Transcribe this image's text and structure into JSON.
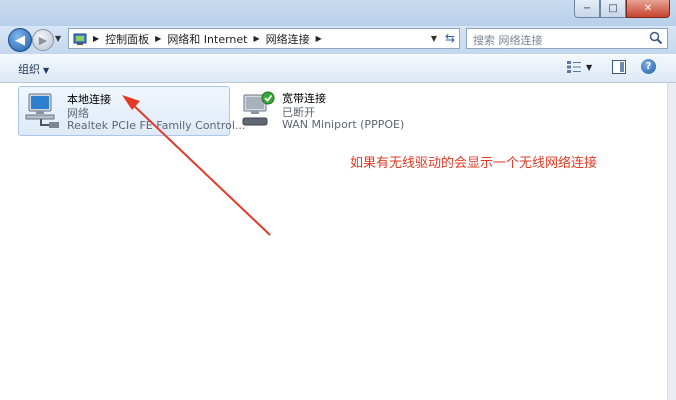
{
  "window": {
    "caption": {
      "minimize_glyph": "−",
      "maximize_glyph": "□",
      "close_glyph": "✕"
    }
  },
  "nav": {
    "back_glyph": "◀",
    "forward_glyph": "▶",
    "breadcrumb": [
      "控制面板",
      "网络和 Internet",
      "网络连接"
    ],
    "search_placeholder": "搜索 网络连接"
  },
  "toolbar": {
    "organize_label": "组织"
  },
  "connections": [
    {
      "name": "本地连接",
      "type": "网络",
      "device": "Realtek PCIe FE Family Control...",
      "selected": true
    },
    {
      "name": "宽带连接",
      "type": "已断开",
      "device": "WAN Miniport (PPPOE)",
      "selected": false
    }
  ],
  "annotation": {
    "text": "如果有无线驱动的会显示一个无线网络连接",
    "color": "#e23a25"
  },
  "colors": {
    "accent": "#1f5fa8",
    "annotation": "#e23a25",
    "selection": "#dfeaf8"
  }
}
